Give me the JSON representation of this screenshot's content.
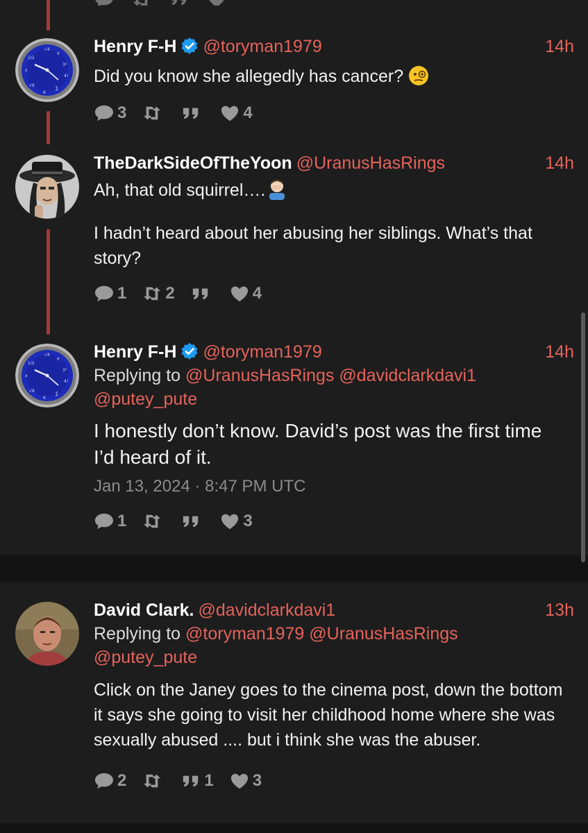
{
  "posts": [
    {
      "name": "Henry F-H",
      "handle": "@toryman1979",
      "time": "14h",
      "text": "Did you know she allegedly has cancer?",
      "emoji": "face-with-monocle",
      "replies": "3",
      "reposts": "",
      "quotes": "",
      "likes": "4"
    },
    {
      "name": "TheDarkSideOfTheYoon",
      "handle": "@UranusHasRings",
      "time": "14h",
      "text_line1": "Ah, that old squirrel….",
      "emoji": "man-facepalming",
      "text_para2": "I hadn’t heard about her abusing her siblings.  What’s that story?",
      "replies": "1",
      "reposts": "2",
      "quotes": "",
      "likes": "4"
    },
    {
      "name": "Henry F-H",
      "handle": "@toryman1979",
      "time": "14h",
      "replying_label": "Replying to",
      "mentions_line1": "@UranusHasRings @davidclarkdavi1",
      "mentions_line2": "@putey_pute",
      "text": "I honestly don’t know. David’s post was the first time I’d heard of it.",
      "date": "Jan 13, 2024 · 8:47 PM UTC",
      "replies": "1",
      "reposts": "",
      "quotes": "",
      "likes": "3"
    },
    {
      "name": "David Clark.",
      "handle": "@davidclarkdavi1",
      "time": "13h",
      "replying_label": "Replying to",
      "mentions_line1": "@toryman1979 @UranusHasRings",
      "mentions_line2": "@putey_pute",
      "text": "Click on the Janey goes to the cinema post, down the bottom it says she going to visit her childhood home where she was sexually abused .... but i think she was the abuser.",
      "replies": "2",
      "reposts": "",
      "quotes": "1",
      "likes": "3"
    }
  ],
  "colors": {
    "background": "#1d1d1d",
    "accent": "#e5635b",
    "thread_line": "#a23a3a",
    "verified": "#1d9bf0",
    "muted": "#9a9a9a"
  }
}
